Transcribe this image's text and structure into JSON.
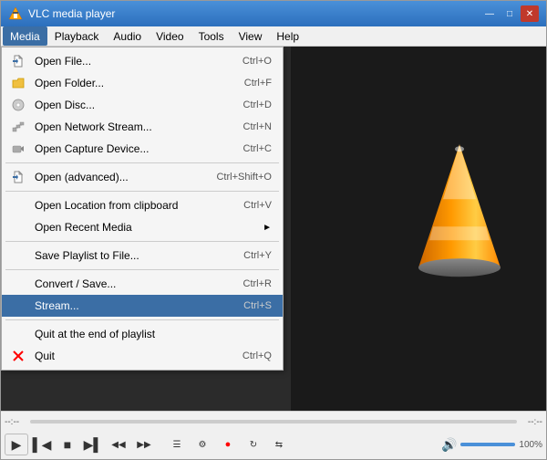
{
  "window": {
    "title": "VLC media player",
    "titlebar_icon": "🎬"
  },
  "menubar": {
    "items": [
      {
        "id": "media",
        "label": "Media",
        "active": true
      },
      {
        "id": "playback",
        "label": "Playback",
        "active": false
      },
      {
        "id": "audio",
        "label": "Audio",
        "active": false
      },
      {
        "id": "video",
        "label": "Video",
        "active": false
      },
      {
        "id": "tools",
        "label": "Tools",
        "active": false
      },
      {
        "id": "view",
        "label": "View",
        "active": false
      },
      {
        "id": "help",
        "label": "Help",
        "active": false
      }
    ]
  },
  "media_menu": {
    "items": [
      {
        "id": "open-file",
        "label": "Open File...",
        "shortcut": "Ctrl+O",
        "icon": "▶",
        "separator_after": false
      },
      {
        "id": "open-folder",
        "label": "Open Folder...",
        "shortcut": "Ctrl+F",
        "icon": "📁",
        "separator_after": false
      },
      {
        "id": "open-disc",
        "label": "Open Disc...",
        "shortcut": "Ctrl+D",
        "icon": "💿",
        "separator_after": false
      },
      {
        "id": "open-network",
        "label": "Open Network Stream...",
        "shortcut": "Ctrl+N",
        "icon": "🌐",
        "separator_after": false
      },
      {
        "id": "open-capture",
        "label": "Open Capture Device...",
        "shortcut": "Ctrl+C",
        "icon": "📷",
        "separator_after": true
      },
      {
        "id": "open-advanced",
        "label": "Open (advanced)...",
        "shortcut": "Ctrl+Shift+O",
        "icon": "▶",
        "separator_after": true
      },
      {
        "id": "open-location",
        "label": "Open Location from clipboard",
        "shortcut": "Ctrl+V",
        "icon": "",
        "separator_after": false
      },
      {
        "id": "open-recent",
        "label": "Open Recent Media",
        "shortcut": "",
        "icon": "",
        "arrow": "▶",
        "separator_after": true
      },
      {
        "id": "save-playlist",
        "label": "Save Playlist to File...",
        "shortcut": "Ctrl+Y",
        "icon": "",
        "separator_after": true
      },
      {
        "id": "convert-save",
        "label": "Convert / Save...",
        "shortcut": "Ctrl+R",
        "icon": "",
        "separator_after": false
      },
      {
        "id": "stream",
        "label": "Stream...",
        "shortcut": "Ctrl+S",
        "icon": "",
        "highlighted": true,
        "separator_after": true
      },
      {
        "id": "quit-playlist",
        "label": "Quit at the end of playlist",
        "shortcut": "",
        "icon": "",
        "separator_after": false
      },
      {
        "id": "quit",
        "label": "Quit",
        "shortcut": "Ctrl+Q",
        "icon": "✕",
        "icon_color": "red",
        "separator_after": false
      }
    ]
  },
  "controls": {
    "seek_start": "--:--",
    "seek_end": "--:--",
    "volume_pct": "100%",
    "buttons": [
      "play",
      "prev",
      "stop",
      "next",
      "skip-back",
      "skip-fwd",
      "toggle-playlist",
      "extended",
      "record",
      "loop",
      "random"
    ]
  }
}
